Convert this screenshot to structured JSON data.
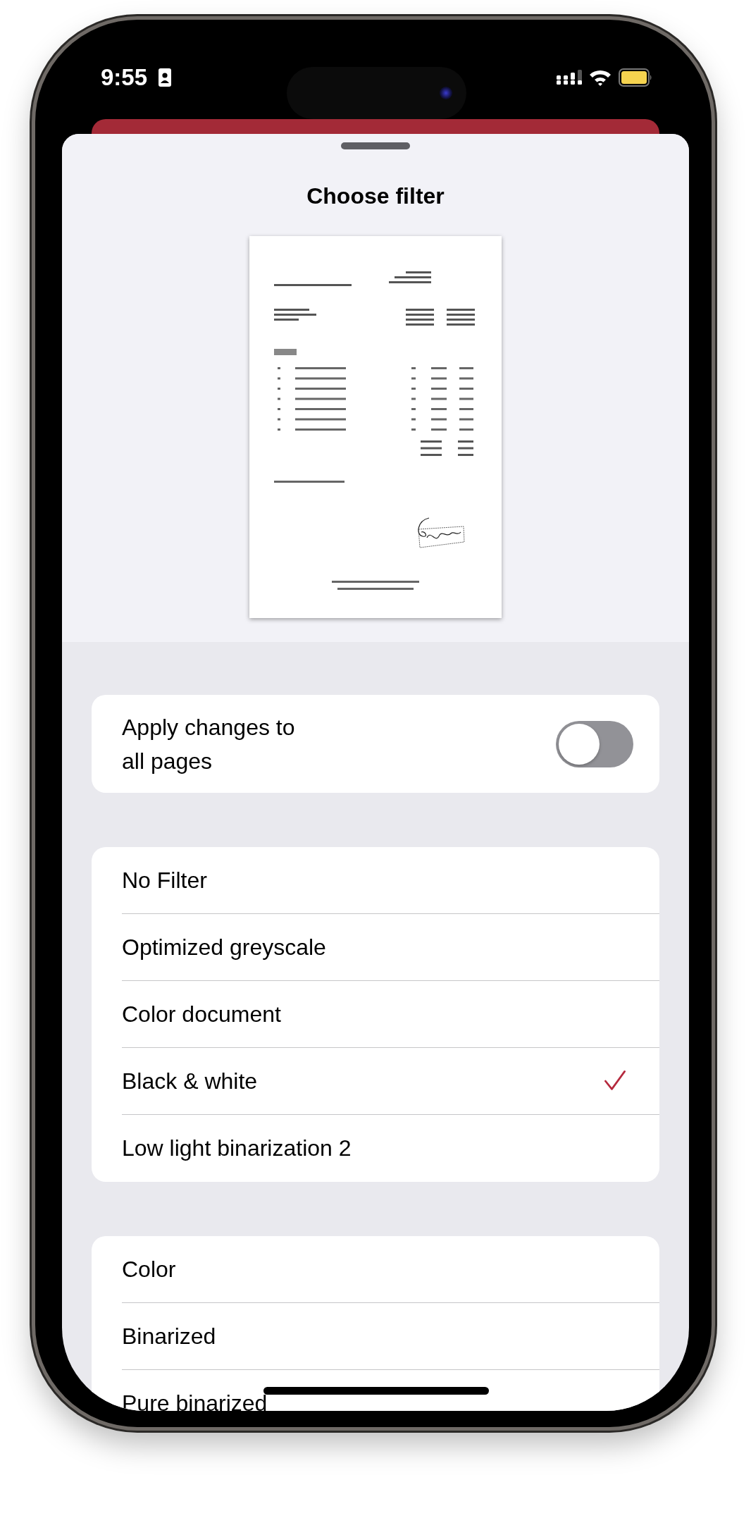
{
  "status_bar": {
    "time": "9:55"
  },
  "sheet": {
    "title": "Choose filter"
  },
  "apply_to_all": {
    "label": "Apply changes to all pages",
    "on": false
  },
  "filters": [
    {
      "label": "No Filter",
      "selected": false
    },
    {
      "label": "Optimized greyscale",
      "selected": false
    },
    {
      "label": "Color document",
      "selected": false
    },
    {
      "label": "Black & white",
      "selected": true
    },
    {
      "label": "Low light binarization 2",
      "selected": false
    }
  ],
  "more_filters": [
    {
      "label": "Color",
      "selected": false
    },
    {
      "label": "Binarized",
      "selected": false
    },
    {
      "label": "Pure binarized",
      "selected": false
    }
  ]
}
